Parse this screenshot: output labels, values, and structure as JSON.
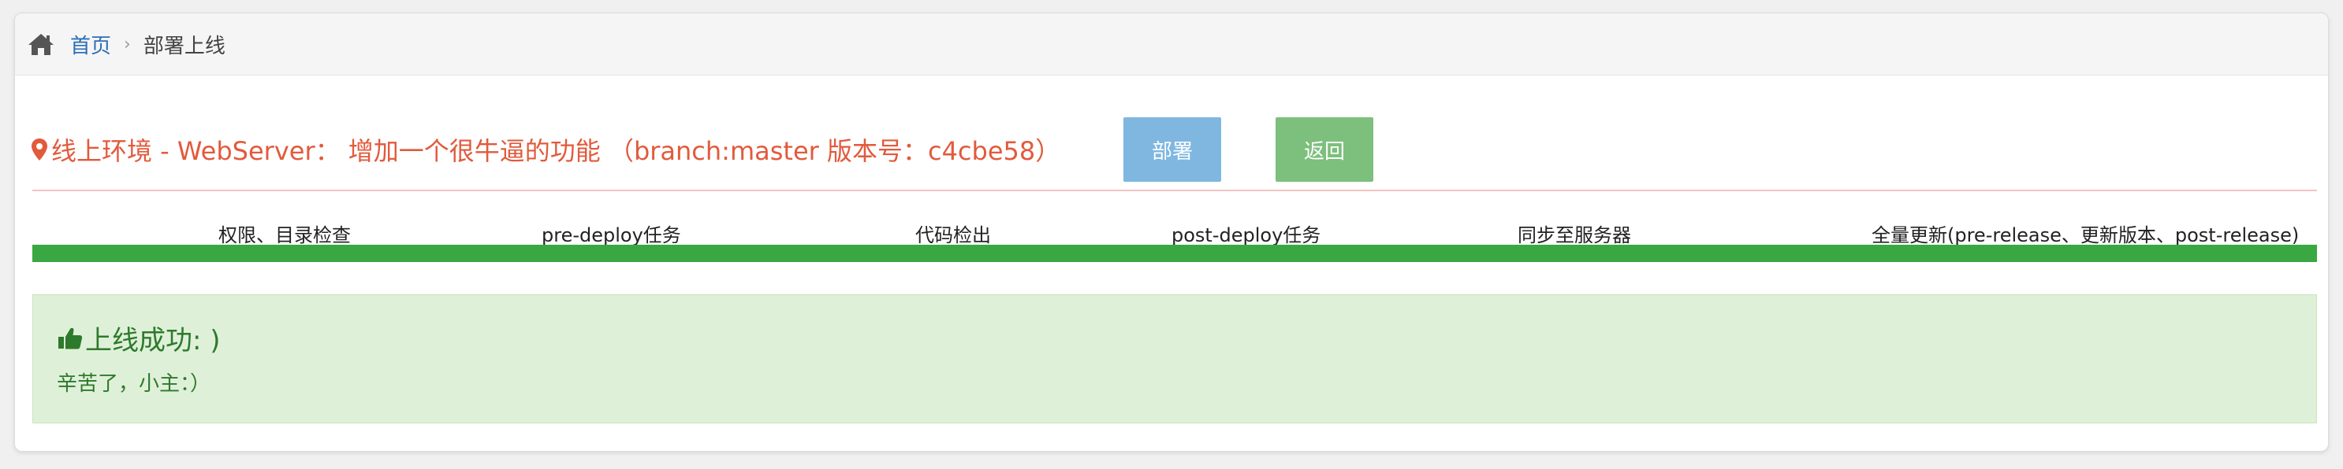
{
  "breadcrumb": {
    "home_icon": "home-icon",
    "home_label": "首页",
    "separator": "›",
    "current": "部署上线"
  },
  "task": {
    "marker_icon": "map-marker-icon",
    "title": "线上环境 - WebServer： 增加一个很牛逼的功能 （branch:master 版本号：c4cbe58）",
    "title_color": "#e25a3c"
  },
  "buttons": {
    "deploy": "部署",
    "back": "返回"
  },
  "steps": [
    {
      "label": "权限、目录检查"
    },
    {
      "label": "pre-deploy任务"
    },
    {
      "label": "代码检出"
    },
    {
      "label": "post-deploy任务"
    },
    {
      "label": "同步至服务器"
    },
    {
      "label": "全量更新(pre-release、更新版本、post-release)"
    }
  ],
  "progress": {
    "percent": 100,
    "color": "#3aa842"
  },
  "result": {
    "icon": "thumbs-up-icon",
    "heading": "上线成功: )",
    "message": "辛苦了，小主：）"
  }
}
